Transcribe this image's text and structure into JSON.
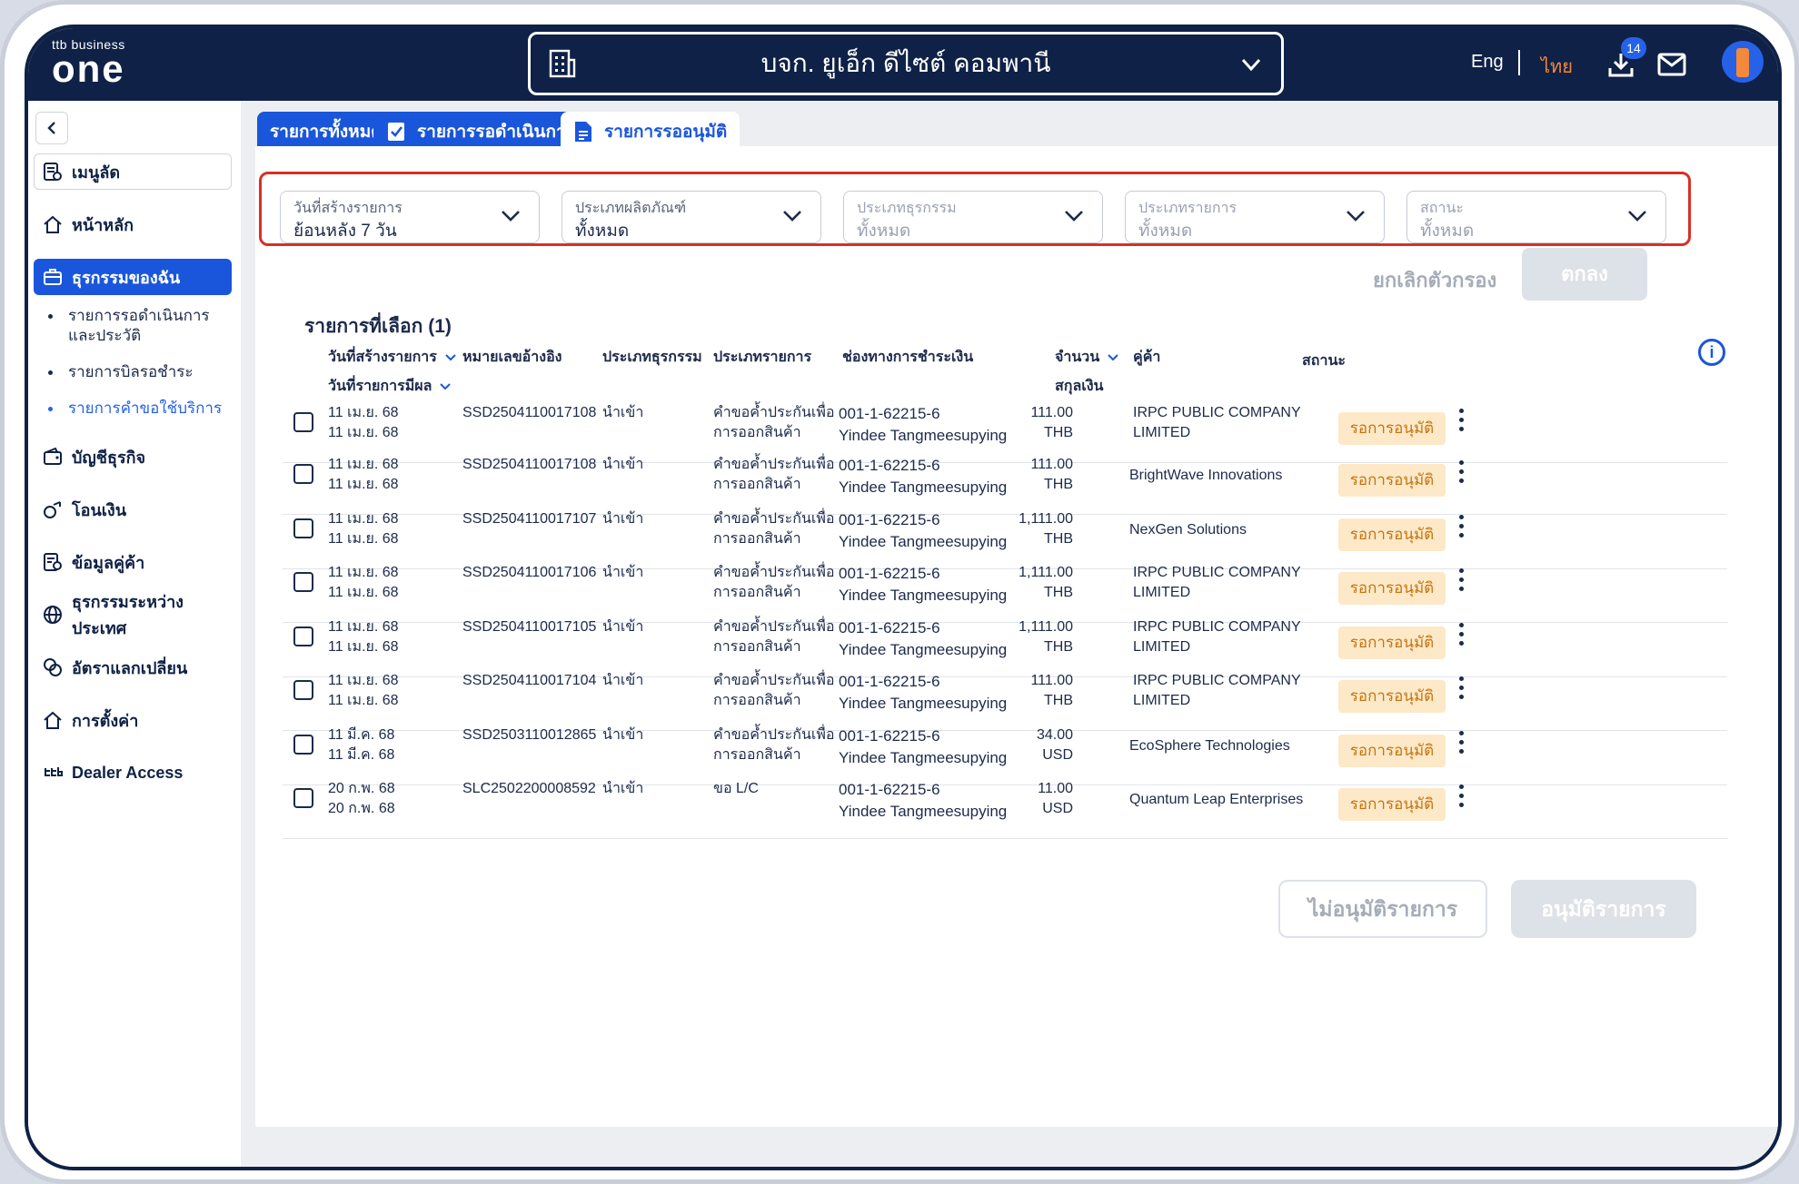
{
  "brand": {
    "small": "ttb business",
    "big": "one"
  },
  "company": {
    "name": "บจก. ยูเอ็ก ดีไซต์ คอมพานี"
  },
  "header": {
    "lang_eng": "Eng",
    "lang_thai": "ไทย",
    "download_count": "14"
  },
  "sidebar": {
    "quick_menu": "เมนูลัด",
    "items": [
      {
        "label": "หน้าหลัก",
        "icon": "home-icon"
      },
      {
        "label": "ธุรกรรมของฉัน",
        "icon": "briefcase-icon"
      },
      {
        "label": "บัญชีธุรกิจ",
        "icon": "wallet-icon"
      },
      {
        "label": "โอนเงิน",
        "icon": "transfer-icon"
      },
      {
        "label": "ข้อมูลคู่ค้า",
        "icon": "partner-icon"
      },
      {
        "label": "ธุรกรรมระหว่างประเทศ",
        "icon": "globe-icon"
      },
      {
        "label": "อัตราแลกเปลี่ยน",
        "icon": "exchange-icon"
      },
      {
        "label": "การตั้งค่า",
        "icon": "settings-icon"
      },
      {
        "label": "Dealer Access",
        "icon": "ttb-icon"
      }
    ],
    "subitems": [
      {
        "label": "รายการรอดำเนินการ และประวัติ"
      },
      {
        "label": "รายการบิลรอชำระ"
      },
      {
        "label": "รายการคำขอใช้บริการ"
      }
    ]
  },
  "tabs": [
    {
      "label": "รายการทั้งหมด"
    },
    {
      "label": "รายการรอดำเนินการ"
    },
    {
      "label": "รายการรออนุมัติ"
    }
  ],
  "filters": [
    {
      "label": "วันที่สร้างรายการ",
      "value": "ย้อนหลัง 7 วัน"
    },
    {
      "label": "ประเภทผลิตภัณฑ์",
      "value": "ทั้งหมด"
    },
    {
      "label": "ประเภทธุรกรรม",
      "value": "ทั้งหมด"
    },
    {
      "label": "ประเภทรายการ",
      "value": "ทั้งหมด"
    },
    {
      "label": "สถานะ",
      "value": "ทั้งหมด"
    }
  ],
  "actions": {
    "clear": "ยกเลิกตัวกรอง",
    "ok": "ตกลง",
    "reject": "ไม่อนุมัติรายการ",
    "approve": "อนุมัติรายการ"
  },
  "table": {
    "selected_label": "รายการที่เลือก (1)",
    "headers": {
      "created": "วันที่สร้างรายการ",
      "effective": "วันที่รายการมีผล",
      "ref": "หมายเลขอ้างอิง",
      "txn_type": "ประเภทธุรกรรม",
      "item_type": "ประเภทรายการ",
      "channel": "ช่องทางการชำระเงิน",
      "amount": "จำนวน",
      "currency": "สกุลเงิน",
      "partner": "คู่ค้า",
      "status": "สถานะ"
    },
    "rows": [
      {
        "d1": "11 เม.ย. 68",
        "d2": "11 เม.ย. 68",
        "ref": "SSD2504110017108",
        "txn": "นำเข้า",
        "item1": "คำขอค้ำประกันเพื่อ",
        "item2": "การออกสินค้า",
        "acc": "001-1-62215-6",
        "accname": "Yindee Tangmeesupying",
        "amt": "111.00",
        "cur": "THB",
        "p1": "IRPC PUBLIC COMPANY",
        "p2": "LIMITED",
        "status": "รอการอนุมัติ"
      },
      {
        "d1": "11 เม.ย. 68",
        "d2": "11 เม.ย. 68",
        "ref": "SSD2504110017108",
        "txn": "นำเข้า",
        "item1": "คำขอค้ำประกันเพื่อ",
        "item2": "การออกสินค้า",
        "acc": "001-1-62215-6",
        "accname": "Yindee Tangmeesupying",
        "amt": "111.00",
        "cur": "THB",
        "p1": "BrightWave Innovations",
        "p2": "",
        "status": "รอการอนุมัติ"
      },
      {
        "d1": "11 เม.ย. 68",
        "d2": "11 เม.ย. 68",
        "ref": "SSD2504110017107",
        "txn": "นำเข้า",
        "item1": "คำขอค้ำประกันเพื่อ",
        "item2": "การออกสินค้า",
        "acc": "001-1-62215-6",
        "accname": "Yindee Tangmeesupying",
        "amt": "1,111.00",
        "cur": "THB",
        "p1": "NexGen Solutions",
        "p2": "",
        "status": "รอการอนุมัติ"
      },
      {
        "d1": "11 เม.ย. 68",
        "d2": "11 เม.ย. 68",
        "ref": "SSD2504110017106",
        "txn": "นำเข้า",
        "item1": "คำขอค้ำประกันเพื่อ",
        "item2": "การออกสินค้า",
        "acc": "001-1-62215-6",
        "accname": "Yindee Tangmeesupying",
        "amt": "1,111.00",
        "cur": "THB",
        "p1": "IRPC PUBLIC COMPANY",
        "p2": "LIMITED",
        "status": "รอการอนุมัติ"
      },
      {
        "d1": "11 เม.ย. 68",
        "d2": "11 เม.ย. 68",
        "ref": "SSD2504110017105",
        "txn": "นำเข้า",
        "item1": "คำขอค้ำประกันเพื่อ",
        "item2": "การออกสินค้า",
        "acc": "001-1-62215-6",
        "accname": "Yindee Tangmeesupying",
        "amt": "1,111.00",
        "cur": "THB",
        "p1": "IRPC PUBLIC COMPANY",
        "p2": "LIMITED",
        "status": "รอการอนุมัติ"
      },
      {
        "d1": "11 เม.ย. 68",
        "d2": "11 เม.ย. 68",
        "ref": "SSD2504110017104",
        "txn": "นำเข้า",
        "item1": "คำขอค้ำประกันเพื่อ",
        "item2": "การออกสินค้า",
        "acc": "001-1-62215-6",
        "accname": "Yindee Tangmeesupying",
        "amt": "111.00",
        "cur": "THB",
        "p1": "IRPC PUBLIC COMPANY",
        "p2": "LIMITED",
        "status": "รอการอนุมัติ"
      },
      {
        "d1": "11 มี.ค. 68",
        "d2": "11 มี.ค. 68",
        "ref": "SSD2503110012865",
        "txn": "นำเข้า",
        "item1": "คำขอค้ำประกันเพื่อ",
        "item2": "การออกสินค้า",
        "acc": "001-1-62215-6",
        "accname": "Yindee Tangmeesupying",
        "amt": "34.00",
        "cur": "USD",
        "p1": "EcoSphere Technologies",
        "p2": "",
        "status": "รอการอนุมัติ"
      },
      {
        "d1": "20 ก.พ. 68",
        "d2": "20 ก.พ. 68",
        "ref": "SLC2502200008592",
        "txn": "นำเข้า",
        "item1": "ขอ L/C",
        "item2": "",
        "acc": "001-1-62215-6",
        "accname": "Yindee Tangmeesupying",
        "amt": "11.00",
        "cur": "USD",
        "p1": "Quantum Leap Enterprises",
        "p2": "",
        "status": "รอการอนุมัติ"
      }
    ]
  }
}
